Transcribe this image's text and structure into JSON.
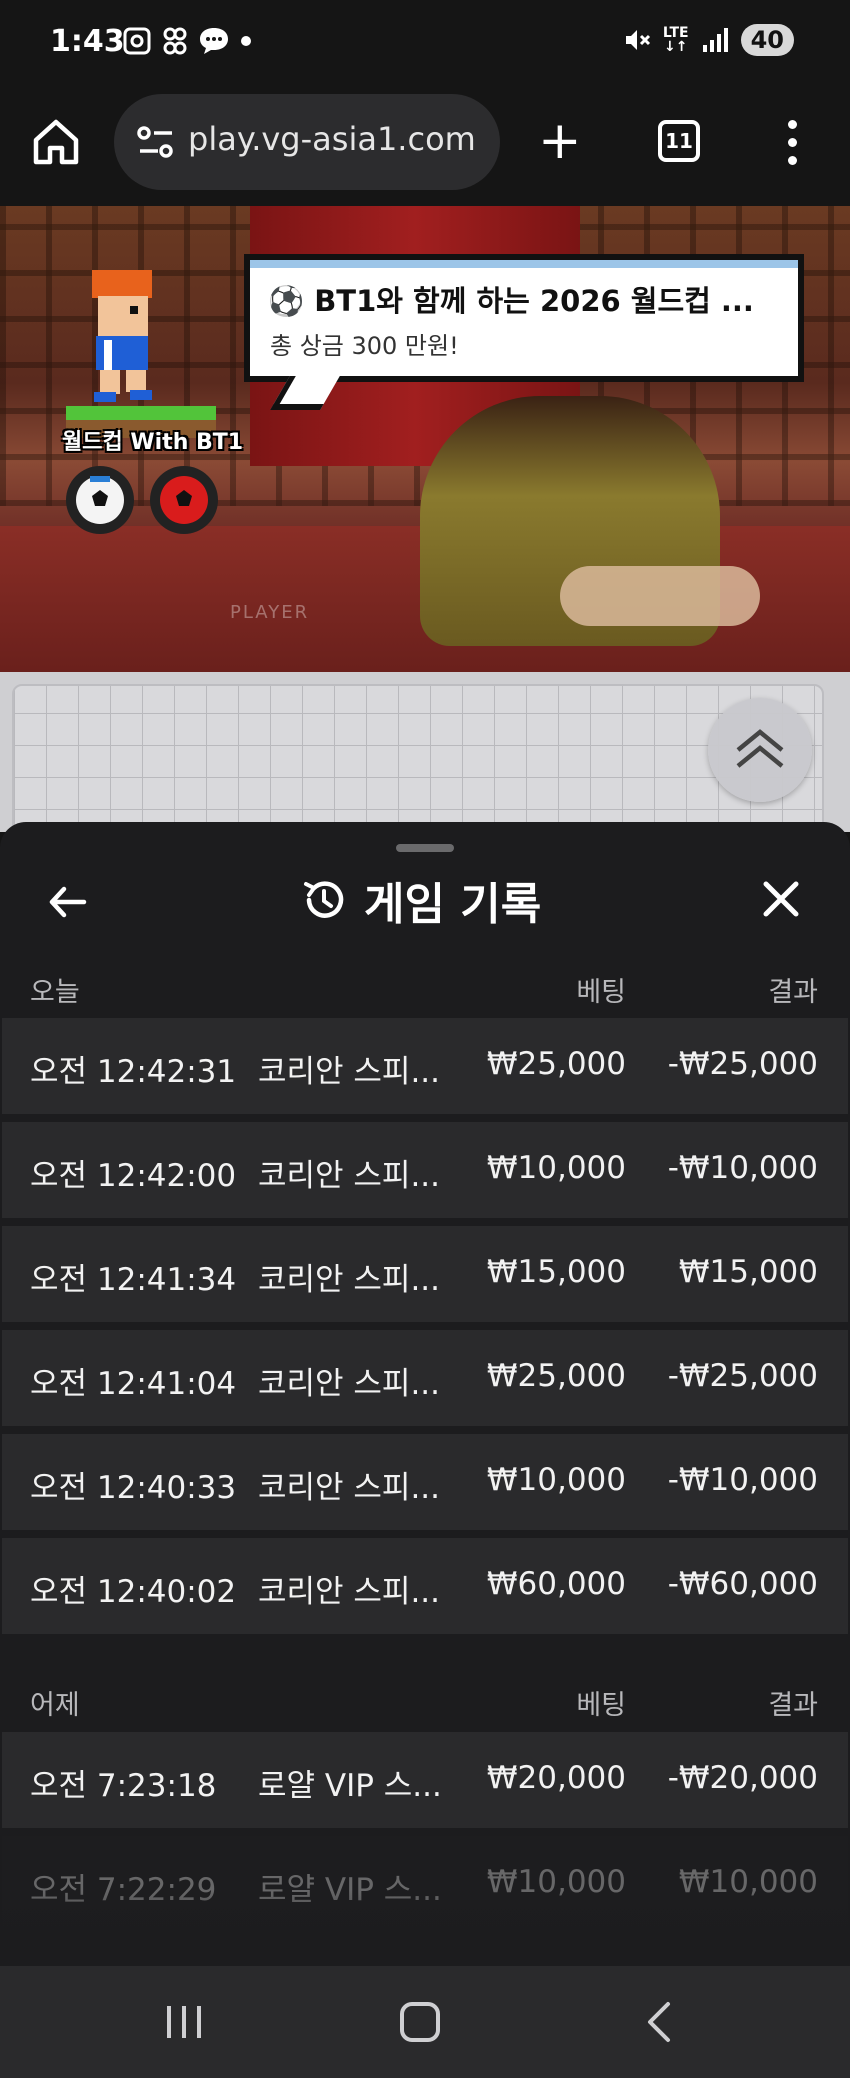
{
  "status_bar": {
    "time": "1:43",
    "left_icons": [
      "screenshot-icon",
      "app-icon",
      "chat-icon",
      "dot-icon"
    ],
    "right_icons": [
      "mute-icon",
      "lte-signal-icon",
      "signal-icon"
    ],
    "network": "LTE",
    "battery": "40"
  },
  "browser": {
    "url": "play.vg-asia1.com",
    "tab_count": "11"
  },
  "banner": {
    "character_label": "월드컵 With BT1",
    "bubble_title": "⚽ BT1와 함께 하는 2026 월드컵 ...",
    "bubble_subtitle": "총 상금 300 만원!",
    "table_label": "PLAYER"
  },
  "sheet": {
    "title": "게임 기록",
    "sections": [
      {
        "label": "오늘",
        "bet_header": "베팅",
        "result_header": "결과",
        "rows": [
          {
            "time": "오전 12:42:31",
            "game": "코리안 스피...",
            "bet": "₩25,000",
            "result": "-₩25,000"
          },
          {
            "time": "오전 12:42:00",
            "game": "코리안 스피...",
            "bet": "₩10,000",
            "result": "-₩10,000"
          },
          {
            "time": "오전 12:41:34",
            "game": "코리안 스피...",
            "bet": "₩15,000",
            "result": "₩15,000"
          },
          {
            "time": "오전 12:41:04",
            "game": "코리안 스피...",
            "bet": "₩25,000",
            "result": "-₩25,000"
          },
          {
            "time": "오전 12:40:33",
            "game": "코리안 스피...",
            "bet": "₩10,000",
            "result": "-₩10,000"
          },
          {
            "time": "오전 12:40:02",
            "game": "코리안 스피...",
            "bet": "₩60,000",
            "result": "-₩60,000"
          }
        ]
      },
      {
        "label": "어제",
        "bet_header": "베팅",
        "result_header": "결과",
        "rows": [
          {
            "time": "오전 7:23:18",
            "game": "로얄 VIP 스...",
            "bet": "₩20,000",
            "result": "-₩20,000"
          },
          {
            "time": "오전 7:22:29",
            "game": "로얄 VIP 스...",
            "bet": "₩10,000",
            "result": "₩10,000"
          }
        ]
      }
    ]
  }
}
